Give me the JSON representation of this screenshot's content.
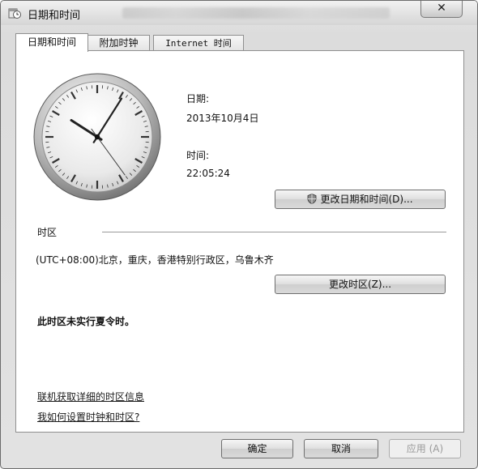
{
  "window": {
    "title": "日期和时间",
    "close_glyph": "✕"
  },
  "tabs": [
    {
      "label": "日期和时间",
      "active": true
    },
    {
      "label": "附加时钟",
      "active": false
    },
    {
      "label": "Internet 时间",
      "active": false
    }
  ],
  "datetime": {
    "date_label": "日期:",
    "date_value": "2013年10月4日",
    "time_label": "时间:",
    "time_value": "22:05:24",
    "change_button": "更改日期和时间(D)..."
  },
  "timezone": {
    "section_label": "时区",
    "value": "(UTC+08:00)北京，重庆，香港特别行政区，乌鲁木齐",
    "change_button": "更改时区(Z)...",
    "dst_note": "此时区未实行夏令时。"
  },
  "links": {
    "online_info": "联机获取详细的时区信息",
    "how_to": "我如何设置时钟和时区?"
  },
  "footer": {
    "ok": "确定",
    "cancel": "取消",
    "apply": "应用 (A)"
  },
  "clock": {
    "hour": 22,
    "minute": 5,
    "second": 24
  }
}
